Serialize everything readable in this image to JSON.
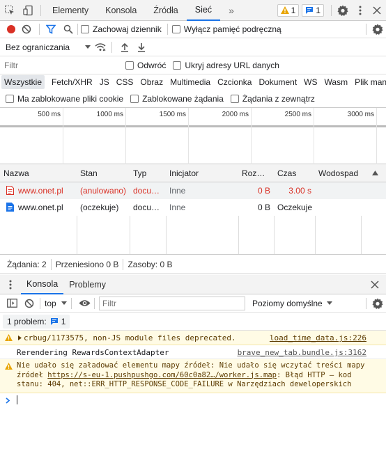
{
  "top_tabs": {
    "elements": "Elementy",
    "console": "Konsola",
    "sources": "Źródła",
    "network": "Sieć",
    "more": "»",
    "warn_count": "1",
    "msg_count": "1"
  },
  "net_toolbar": {
    "preserve_log": "Zachowaj dziennik",
    "disable_cache": "Wyłącz pamięć podręczną",
    "throttle": "Bez ograniczania"
  },
  "filter_bar": {
    "placeholder": "Filtr",
    "invert": "Odwróć",
    "hide_data_urls": "Ukryj adresy URL danych"
  },
  "type_filters": [
    "Wszystkie",
    "Fetch/XHR",
    "JS",
    "CSS",
    "Obraz",
    "Multimedia",
    "Czcionka",
    "Dokument",
    "WS",
    "Wasm",
    "Plik man"
  ],
  "block_bar": {
    "blocked_cookies": "Ma zablokowane pliki cookie",
    "blocked_requests": "Zablokowane żądania",
    "third_party": "Żądania z zewnątrz"
  },
  "timeline_ticks": [
    "500 ms",
    "1000 ms",
    "1500 ms",
    "2000 ms",
    "2500 ms",
    "3000 ms"
  ],
  "table": {
    "headers": {
      "name": "Nazwa",
      "status": "Stan",
      "type": "Typ",
      "initiator": "Inicjator",
      "size": "Roz…",
      "time": "Czas",
      "waterfall": "Wodospad"
    },
    "rows": [
      {
        "name": "www.onet.pl",
        "status": "(anulowano)",
        "type": "docu…",
        "initiator": "Inne",
        "size": "0 B",
        "time": "3.00 s",
        "error": true
      },
      {
        "name": "www.onet.pl",
        "status": "(oczekuje)",
        "type": "docu…",
        "initiator": "Inne",
        "size": "0 B",
        "time": "Oczekuje",
        "error": false
      }
    ]
  },
  "status_bar": {
    "requests": "Żądania: 2",
    "transferred": "Przeniesiono 0 B",
    "resources": "Zasoby: 0 B"
  },
  "drawer": {
    "console_tab": "Konsola",
    "issues_tab": "Problemy",
    "context": "top",
    "filter_placeholder": "Filtr",
    "levels": "Poziomy domyślne",
    "issues_label": "1 problem:",
    "issues_count": "1"
  },
  "console_messages": [
    {
      "text": "crbug/1173575, non-JS module files deprecated.",
      "source": "load_time_data.js:226"
    },
    {
      "text": "Rerendering RewardsContextAdapter",
      "source": "brave_new_tab.bundle.js:3162"
    },
    {
      "text_a": "Nie udało się załadować elementu mapy źródeł: Nie udało się wczytać treści mapy źródeł ",
      "link": "https://s-eu-1.pushpushgo.com/60c0a82…/worker.js.map",
      "text_b": ": Błąd HTTP – kod stanu: 404, net::ERR_HTTP_RESPONSE_CODE_FAILURE w Narzędziach deweloperskich"
    }
  ],
  "colors": {
    "error": "#d93025",
    "accent": "#1a73e8",
    "warning_bg": "#fffbe5",
    "warning_icon": "#e8a400",
    "selected_tab_bg": "#e3e6ea"
  }
}
